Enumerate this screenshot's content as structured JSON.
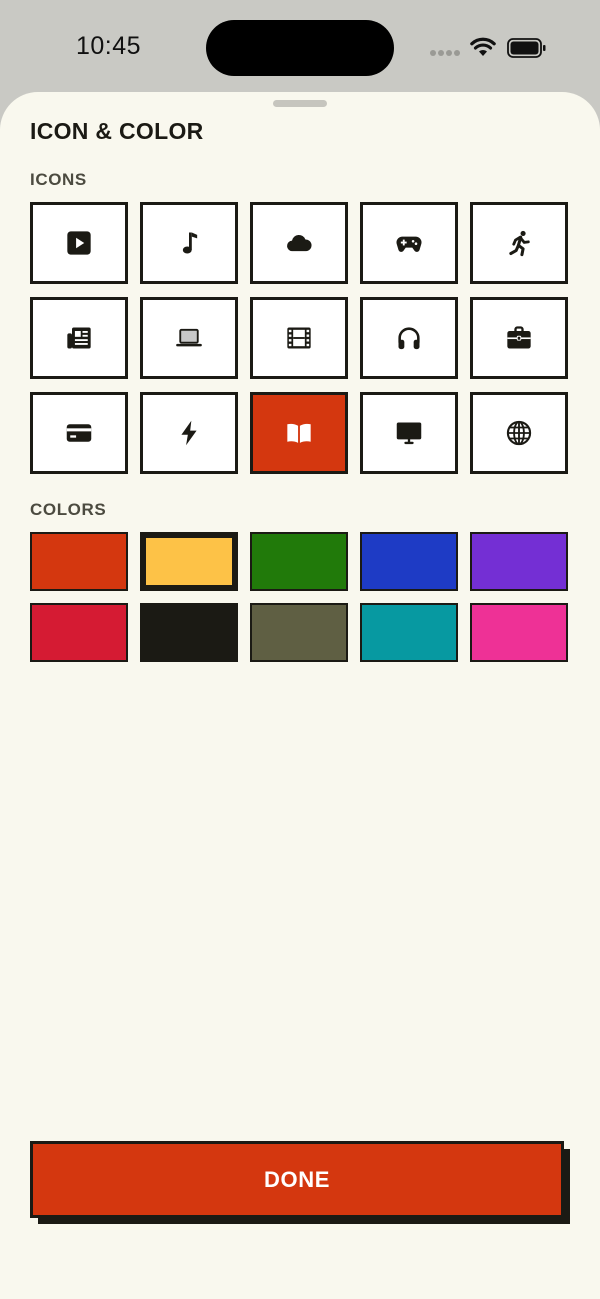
{
  "status_bar": {
    "time": "10:45"
  },
  "sheet": {
    "title": "ICON & COLOR",
    "icons_label": "ICONS",
    "colors_label": "COLORS",
    "done_label": "DONE"
  },
  "icons": [
    {
      "name": "play-icon",
      "selected": false
    },
    {
      "name": "music-note-icon",
      "selected": false
    },
    {
      "name": "cloud-icon",
      "selected": false
    },
    {
      "name": "gamepad-icon",
      "selected": false
    },
    {
      "name": "running-figure-icon",
      "selected": false
    },
    {
      "name": "newspaper-icon",
      "selected": false
    },
    {
      "name": "laptop-icon",
      "selected": false
    },
    {
      "name": "film-icon",
      "selected": false
    },
    {
      "name": "headphones-icon",
      "selected": false
    },
    {
      "name": "briefcase-icon",
      "selected": false
    },
    {
      "name": "credit-card-icon",
      "selected": false
    },
    {
      "name": "bolt-icon",
      "selected": false
    },
    {
      "name": "book-icon",
      "selected": true
    },
    {
      "name": "monitor-icon",
      "selected": false
    },
    {
      "name": "globe-icon",
      "selected": false
    }
  ],
  "colors": [
    {
      "hex": "#d4370f",
      "selected": false
    },
    {
      "hex": "#fdc247",
      "selected": true
    },
    {
      "hex": "#217a0a",
      "selected": false
    },
    {
      "hex": "#1e3bc5",
      "selected": false
    },
    {
      "hex": "#742fd4",
      "selected": false
    },
    {
      "hex": "#d51b33",
      "selected": false
    },
    {
      "hex": "#1b1a14",
      "selected": false
    },
    {
      "hex": "#5f5f43",
      "selected": false
    },
    {
      "hex": "#0799a1",
      "selected": false
    },
    {
      "hex": "#ee3196",
      "selected": false
    }
  ],
  "theme": {
    "accent": "#d4370f",
    "ink": "#1b1a14",
    "sheet_background": "#f9f8ee"
  }
}
